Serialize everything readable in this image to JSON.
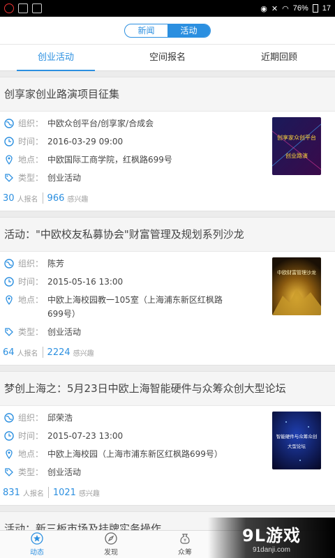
{
  "status_bar": {
    "battery": "76%",
    "time": "17"
  },
  "header": {
    "segments": [
      {
        "label": "新闻",
        "active": false
      },
      {
        "label": "活动",
        "active": true
      }
    ]
  },
  "tabs": [
    {
      "label": "创业活动",
      "active": true
    },
    {
      "label": "空间报名",
      "active": false
    },
    {
      "label": "近期回顾",
      "active": false
    }
  ],
  "labels": {
    "org": "组织：",
    "time": "时间：",
    "place": "地点：",
    "type": "类型：",
    "signup_unit": "人报名",
    "interest_unit": "感兴趣"
  },
  "events": [
    {
      "title": "创享家创业路演项目征集",
      "org": "中欧众创平台/创享家/合成会",
      "time": "2016-03-29 09:00",
      "place": "中欧国际工商学院，红枫路699号",
      "type": "创业活动",
      "signups": "30",
      "interested": "966",
      "thumb_text": "创享家众创平台 创业路演"
    },
    {
      "title": "活动：\"中欧校友私募协会\"财富管理及规划系列沙龙",
      "org": "陈芳",
      "time": "2015-05-16 13:00",
      "place": "中欧上海校园教一105室（上海浦东新区红枫路699号）",
      "type": "创业活动",
      "signups": "64",
      "interested": "2224",
      "thumb_text": "中欧财富管理沙龙"
    },
    {
      "title": "梦创上海之：5月23日中欧上海智能硬件与众筹众创大型论坛",
      "org": "邱荣浩",
      "time": "2015-07-23 13:00",
      "place": "中欧上海校园（上海市浦东新区红枫路699号）",
      "type": "创业活动",
      "signups": "831",
      "interested": "1021",
      "thumb_text": "智能硬件与众筹众创 大型论坛"
    },
    {
      "title": "活动：新三板市场及挂牌实务操作"
    }
  ],
  "bottom_nav": [
    {
      "label": "动态",
      "icon": "star-icon",
      "active": true
    },
    {
      "label": "发现",
      "icon": "compass-icon",
      "active": false
    },
    {
      "label": "众筹",
      "icon": "money-bag-icon",
      "active": false
    }
  ],
  "watermark": {
    "main": "9L游戏",
    "sub": "91danji.com"
  },
  "colors": {
    "accent": "#2b8fe0"
  }
}
